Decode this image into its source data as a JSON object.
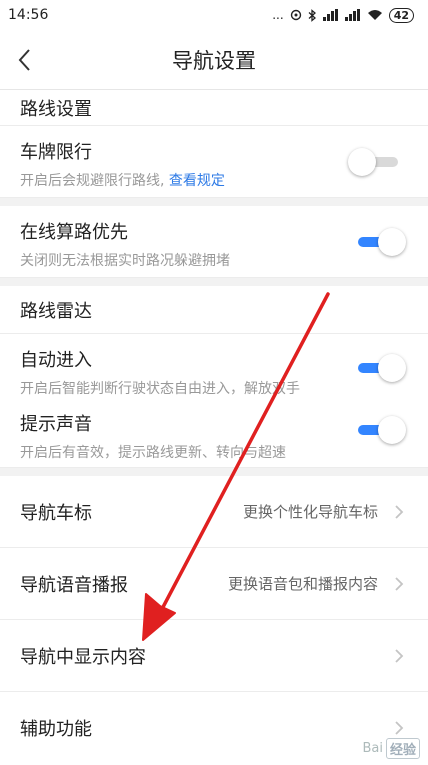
{
  "status": {
    "time": "14:56",
    "signal_text": "...",
    "battery": "42"
  },
  "header": {
    "title": "导航设置"
  },
  "route_settings": {
    "title": "路线设置",
    "plate_limit": {
      "label": "车牌限行",
      "sub": "开启后会规避限行路线, ",
      "link": "查看规定",
      "enabled": false
    },
    "online_priority": {
      "label": "在线算路优先",
      "sub": "关闭则无法根据实时路况躲避拥堵",
      "enabled": true
    }
  },
  "route_radar": {
    "title": "路线雷达",
    "auto_enter": {
      "label": "自动进入",
      "sub": "开启后智能判断行驶状态自由进入，解放双手",
      "enabled": true
    },
    "sound": {
      "label": "提示声音",
      "sub": "开启后有音效，提示路线更新、转向与超速",
      "enabled": true
    }
  },
  "menu": [
    {
      "label": "导航车标",
      "value": "更换个性化导航车标"
    },
    {
      "label": "导航语音播报",
      "value": "更换语音包和播报内容"
    },
    {
      "label": "导航中显示内容",
      "value": ""
    },
    {
      "label": "辅助功能",
      "value": ""
    }
  ],
  "annotation": {
    "arrow_color": "#e02020"
  },
  "watermark": {
    "text": "Bai",
    "badge": "经验"
  },
  "colors": {
    "accent": "#3385ff",
    "link": "#2d7ae6"
  }
}
